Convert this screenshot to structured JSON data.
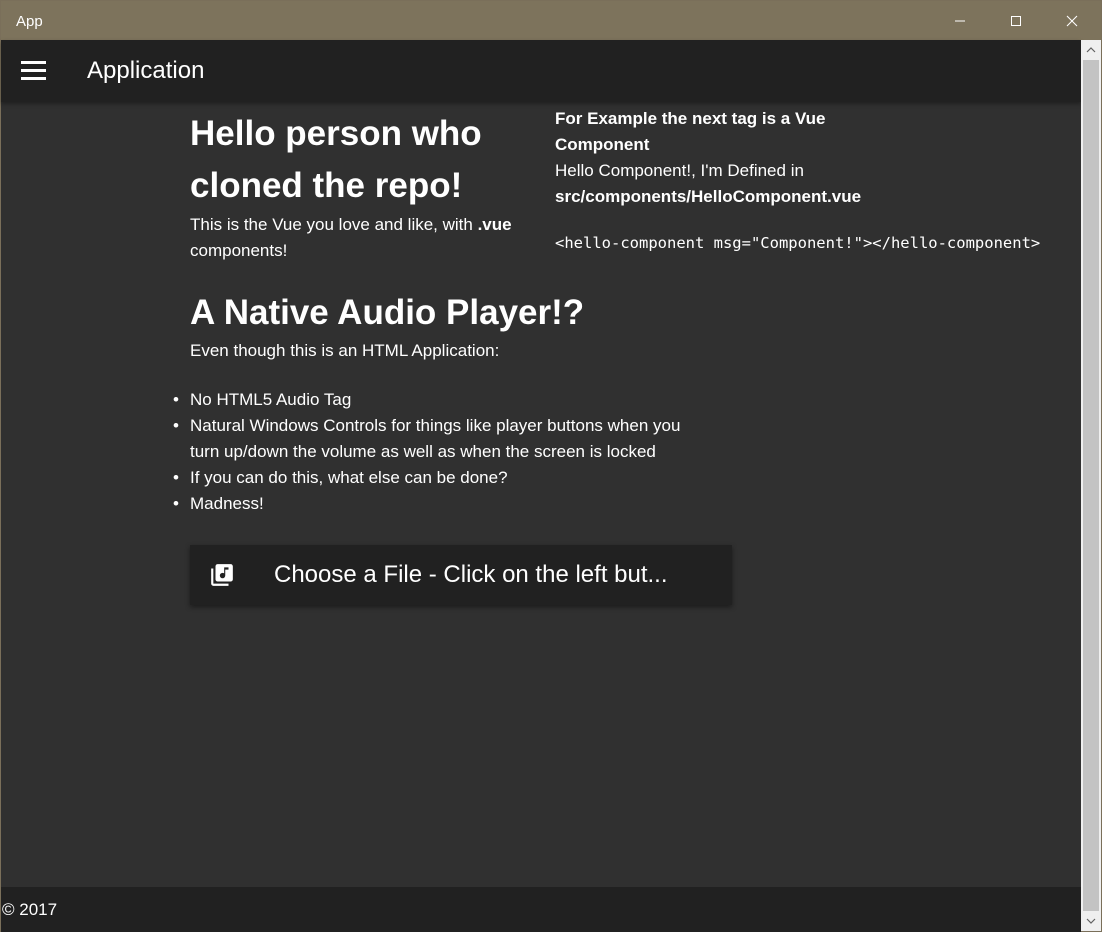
{
  "window": {
    "title": "App",
    "title_bar_color": "#7d735c"
  },
  "appbar": {
    "menu_icon": "hamburger-menu-icon",
    "title": "Application"
  },
  "main": {
    "heading": "Hello person who cloned the repo!",
    "intro_text": "This is the Vue you love and like, with ",
    "intro_bold": ".vue",
    "intro_end": " components!",
    "example": {
      "heading": "For Example the next tag is a Vue Component",
      "line": "Hello Component!, I'm Defined in",
      "path": "src/components/HelloComponent.vue",
      "code": "<hello-component msg=\"Component!\"></hello-component>"
    },
    "player_heading": "A Native Audio Player!?",
    "player_subtext": "Even though this is an HTML Application:",
    "bullets": [
      "No HTML5 Audio Tag",
      "Natural Windows Controls for things like player buttons when you turn up/down the volume as well as when the screen is locked",
      "If you can do this, what else can be done?",
      "Madness!"
    ],
    "file_button": {
      "icon": "library-music-icon",
      "label": "Choose a File - Click on the left but..."
    }
  },
  "footer": {
    "copyright": "© 2017"
  },
  "colors": {
    "background": "#303030",
    "bar": "#212121",
    "text": "#ffffff"
  }
}
